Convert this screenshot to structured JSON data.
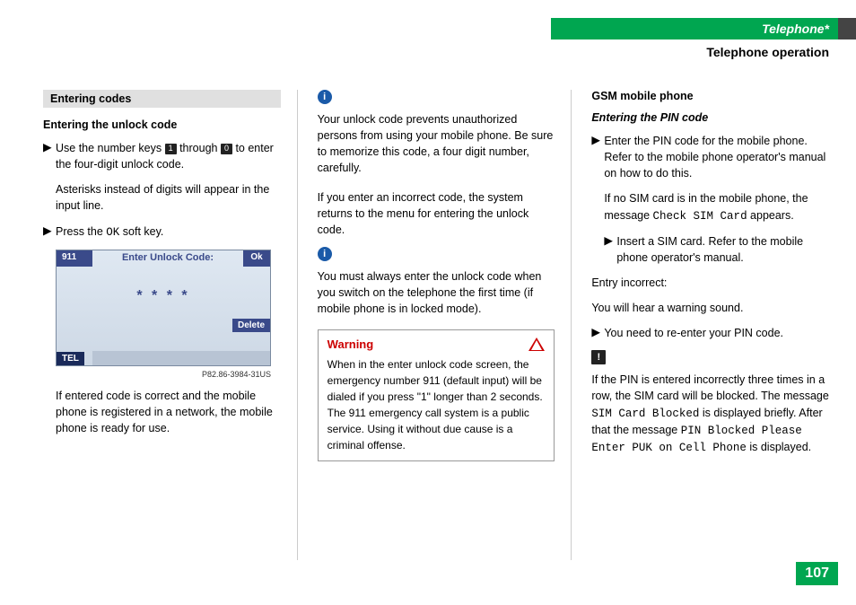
{
  "header": {
    "section": "Telephone*",
    "subsection": "Telephone operation"
  },
  "page_number": "107",
  "col1": {
    "section_label": "Entering codes",
    "h1": "Entering the unlock code",
    "step1_a": "Use the number keys ",
    "key1": "1",
    "step1_b": " through ",
    "key0": "0",
    "step1_c": " to enter the four-digit unlock code.",
    "step1_follow": "Asterisks instead of digits will appear in the input line.",
    "step2_a": "Press the ",
    "ok_key": "OK",
    "step2_b": " soft key.",
    "screenshot": {
      "num": "911",
      "title": "Enter Unlock Code:",
      "ok": "Ok",
      "stars": "* * * *",
      "delete": "Delete",
      "tel": "TEL"
    },
    "caption": "P82.86-3984-31US",
    "after_img": "If entered code is correct and the mobile phone is registered in a network, the mobile phone is ready for use."
  },
  "col2": {
    "info1_a": "Your unlock code prevents unauthorized persons from using your mobile phone. Be sure to memorize this code, a four digit number, carefully.",
    "info1_b": "If you enter an incorrect code, the system returns to the menu for entering the unlock code.",
    "info2": "You must always enter the unlock code when you switch on the telephone the first time (if mobile phone is in locked mode).",
    "warning_title": "Warning",
    "warning_text": "When in the enter unlock code screen, the emergency number 911 (default input) will be dialed if you press \"1\" longer than 2 seconds. The 911 emergency call system is a public service. Using it without due cause is a criminal offense."
  },
  "col3": {
    "h1": "GSM mobile phone",
    "h2": "Entering the PIN code",
    "step1": "Enter the PIN code for the mobile phone. Refer to the mobile phone operator's manual on how to do this.",
    "step1_follow_a": "If no SIM card is in the mobile phone, the message ",
    "check_sim": "Check SIM Card",
    "step1_follow_b": " appears.",
    "nested_step": "Insert a SIM card. Refer to the mobile phone operator's manual.",
    "entry_incorrect": "Entry incorrect:",
    "warning_sound": "You will hear a warning sound.",
    "step_reenter": "You need to re-enter your PIN code.",
    "note_a": "If the PIN is entered incorrectly three times in a row, the SIM card will be blocked. The message ",
    "sim_blocked": "SIM Card Blocked",
    "note_b": " is displayed briefly. After that the message ",
    "pin_blocked": "PIN Blocked Please Enter PUK on Cell Phone",
    "note_c": " is displayed."
  }
}
